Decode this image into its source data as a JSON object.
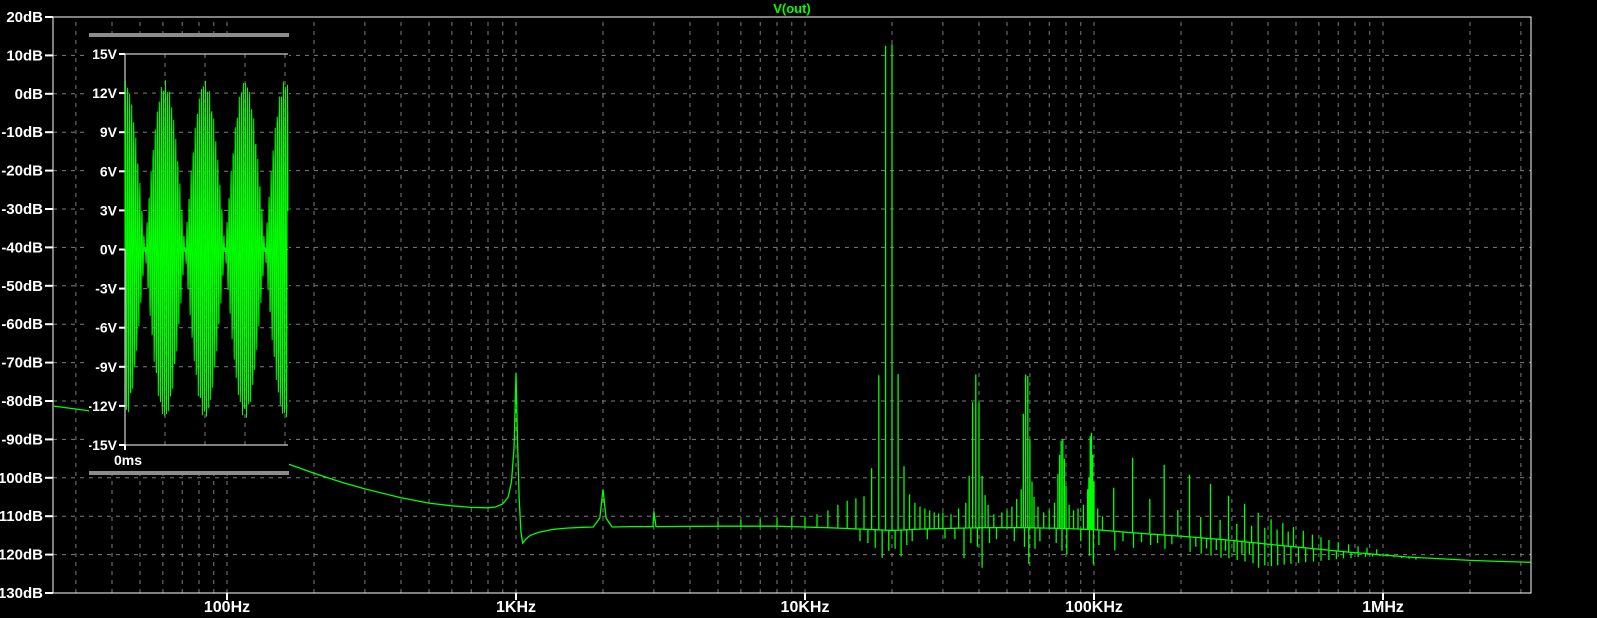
{
  "window": {
    "background": "#000000"
  },
  "colors": {
    "trace": "#00ff00",
    "grid": "#7d7d7d",
    "axis": "#ffffff",
    "text": "#ffffff",
    "title": "#00ff00",
    "pane_border": "#8c8c8c"
  },
  "chart_data": [
    {
      "type": "line",
      "title": "V(out)",
      "name": "fft-spectrum",
      "legend_position": "top-center",
      "grid": "dashed",
      "x_axis": {
        "scale": "log",
        "unit": "Hz",
        "min": 25,
        "max": 3250000,
        "tick_labels": [
          {
            "hz": 100,
            "label": "100Hz"
          },
          {
            "hz": 1000,
            "label": "1KHz"
          },
          {
            "hz": 10000,
            "label": "10KHz"
          },
          {
            "hz": 100000,
            "label": "100KHz"
          },
          {
            "hz": 1000000,
            "label": "1MHz"
          }
        ]
      },
      "y_axis": {
        "unit": "dB",
        "min": -130,
        "max": 20,
        "step": 10,
        "tick_labels": [
          {
            "db": 20,
            "label": "20dB"
          },
          {
            "db": 10,
            "label": "10dB"
          },
          {
            "db": 0,
            "label": "0dB"
          },
          {
            "db": -10,
            "label": "-10dB"
          },
          {
            "db": -20,
            "label": "-20dB"
          },
          {
            "db": -30,
            "label": "-30dB"
          },
          {
            "db": -40,
            "label": "-40dB"
          },
          {
            "db": -50,
            "label": "-50dB"
          },
          {
            "db": -60,
            "label": "-60dB"
          },
          {
            "db": -70,
            "label": "-70dB"
          },
          {
            "db": -80,
            "label": "-80dB"
          },
          {
            "db": -90,
            "label": "-90dB"
          },
          {
            "db": -100,
            "label": "-100dB"
          },
          {
            "db": -110,
            "label": "-110dB"
          },
          {
            "db": -120,
            "label": "-120dB"
          },
          {
            "db": -130,
            "label": "-130dB"
          }
        ]
      },
      "baseline_points_hz_db": [
        [
          25,
          -81.3
        ],
        [
          33,
          -82.5
        ],
        [
          60,
          -88
        ],
        [
          100,
          -92.5
        ],
        [
          163,
          -96.4
        ],
        [
          200,
          -98.8
        ],
        [
          250,
          -101.2
        ],
        [
          300,
          -102.9
        ],
        [
          400,
          -105.2
        ],
        [
          500,
          -106.6
        ],
        [
          600,
          -107.3
        ],
        [
          700,
          -107.7
        ],
        [
          800,
          -107.8
        ],
        [
          850,
          -107.6
        ],
        [
          900,
          -106.8
        ],
        [
          940,
          -105
        ],
        [
          965,
          -101
        ],
        [
          985,
          -92
        ],
        [
          1000,
          -72.6
        ],
        [
          1012,
          -90
        ],
        [
          1025,
          -105
        ],
        [
          1040,
          -114
        ],
        [
          1055,
          -117
        ],
        [
          1080,
          -116
        ],
        [
          1120,
          -115
        ],
        [
          1200,
          -114.2
        ],
        [
          1350,
          -113.4
        ],
        [
          1500,
          -113.1
        ],
        [
          1700,
          -112.9
        ],
        [
          1850,
          -112.8
        ],
        [
          1950,
          -110.5
        ],
        [
          2000,
          -103
        ],
        [
          2050,
          -110.5
        ],
        [
          2150,
          -112.8
        ],
        [
          2500,
          -112.7
        ],
        [
          2980,
          -112.7
        ],
        [
          3000,
          -108.8
        ],
        [
          3050,
          -112.7
        ],
        [
          5000,
          -112.6
        ],
        [
          8000,
          -112.6
        ],
        [
          12000,
          -113
        ],
        [
          15000,
          -113.3
        ],
        [
          20000,
          -113.7
        ],
        [
          26000,
          -113.3
        ],
        [
          40000,
          -113
        ],
        [
          60000,
          -113
        ],
        [
          80000,
          -113.2
        ],
        [
          100000,
          -113.5
        ],
        [
          130000,
          -114.2
        ],
        [
          160000,
          -114.7
        ],
        [
          200000,
          -115.2
        ],
        [
          250000,
          -115.8
        ],
        [
          300000,
          -116.3
        ],
        [
          400000,
          -117.3
        ],
        [
          500000,
          -118
        ],
        [
          600000,
          -118.6
        ],
        [
          700000,
          -119.1
        ],
        [
          800000,
          -119.5
        ],
        [
          900000,
          -119.8
        ],
        [
          1000000,
          -120.1
        ],
        [
          1200000,
          -120.6
        ],
        [
          1500000,
          -121
        ],
        [
          2000000,
          -121.5
        ],
        [
          2600000,
          -121.8
        ],
        [
          3250000,
          -122
        ]
      ],
      "spikes_hz_db": [
        [
          5000,
          -111.3
        ],
        [
          6000,
          -111
        ],
        [
          7000,
          -110.8
        ],
        [
          8000,
          -110.5
        ],
        [
          9000,
          -110.3
        ],
        [
          10000,
          -110
        ],
        [
          11000,
          -109.5
        ],
        [
          12000,
          -108.5
        ],
        [
          13000,
          -107
        ],
        [
          14000,
          -106
        ],
        [
          15000,
          -105.3
        ],
        [
          16000,
          -104.8
        ],
        [
          17000,
          -97.5
        ],
        [
          18000,
          -73.3
        ],
        [
          19000,
          12.5
        ],
        [
          20000,
          12.9
        ],
        [
          21000,
          -73
        ],
        [
          22000,
          -97
        ],
        [
          23000,
          -104.3
        ],
        [
          24000,
          -106.5
        ],
        [
          25000,
          -107.5
        ],
        [
          26000,
          -108
        ],
        [
          27000,
          -108.5
        ],
        [
          28000,
          -109
        ],
        [
          29000,
          -109.3
        ],
        [
          30000,
          -109
        ],
        [
          32000,
          -109.5
        ],
        [
          34000,
          -108
        ],
        [
          36000,
          -106.5
        ],
        [
          37000,
          -99.5
        ],
        [
          38000,
          -80.3
        ],
        [
          39000,
          -73.1
        ],
        [
          40000,
          -80.3
        ],
        [
          41000,
          -99.5
        ],
        [
          42000,
          -104.5
        ],
        [
          43000,
          -107
        ],
        [
          45000,
          -109.5
        ],
        [
          48000,
          -109
        ],
        [
          50000,
          -108.5
        ],
        [
          52000,
          -107.5
        ],
        [
          54000,
          -105.5
        ],
        [
          56000,
          -103
        ],
        [
          57000,
          -83.3
        ],
        [
          58000,
          -73.1
        ],
        [
          59000,
          -73.5
        ],
        [
          60000,
          -90
        ],
        [
          61000,
          -101
        ],
        [
          62000,
          -105
        ],
        [
          64000,
          -107.5
        ],
        [
          67000,
          -109
        ],
        [
          70000,
          -108.5
        ],
        [
          73000,
          -106.5
        ],
        [
          75000,
          -99
        ],
        [
          76000,
          -94
        ],
        [
          77000,
          -90.3
        ],
        [
          78000,
          -90
        ],
        [
          79000,
          -95
        ],
        [
          80000,
          -102
        ],
        [
          82000,
          -107
        ],
        [
          85000,
          -108.5
        ],
        [
          88000,
          -108
        ],
        [
          92000,
          -107
        ],
        [
          95000,
          -103
        ],
        [
          96000,
          -100
        ],
        [
          97000,
          -89.2
        ],
        [
          98000,
          -88.3
        ],
        [
          99000,
          -94
        ],
        [
          100000,
          -101
        ],
        [
          103000,
          -108
        ],
        [
          107000,
          -110
        ],
        [
          117000,
          -102.6
        ],
        [
          136000,
          -94.8
        ],
        [
          156000,
          -105.5
        ],
        [
          175000,
          -96.6
        ],
        [
          195000,
          -108.4
        ],
        [
          214000,
          -99.2
        ],
        [
          234000,
          -110.2
        ],
        [
          253000,
          -101.6
        ],
        [
          273000,
          -111
        ],
        [
          292000,
          -104.7
        ],
        [
          312000,
          -112
        ],
        [
          332000,
          -106.8
        ],
        [
          351000,
          -112.5
        ],
        [
          370000,
          -109.1
        ],
        [
          390000,
          -113
        ],
        [
          410000,
          -110.8
        ],
        [
          430000,
          -113.5
        ],
        [
          450000,
          -111.8
        ],
        [
          470000,
          -114
        ],
        [
          490000,
          -112.8
        ],
        [
          530000,
          -113.8
        ],
        [
          570000,
          -114.8
        ],
        [
          610000,
          -115.5
        ],
        [
          650000,
          -116.2
        ],
        [
          700000,
          -116.8
        ],
        [
          760000,
          -117.3
        ],
        [
          820000,
          -117.8
        ],
        [
          880000,
          -118.2
        ],
        [
          950000,
          -118.6
        ]
      ],
      "notches_hz_db": [
        [
          15500,
          -116.5
        ],
        [
          16500,
          -117
        ],
        [
          17500,
          -118.2
        ],
        [
          18500,
          -120.8
        ],
        [
          19500,
          -119
        ],
        [
          20500,
          -118.5
        ],
        [
          21500,
          -120.5
        ],
        [
          22500,
          -117.5
        ],
        [
          23500,
          -116.5
        ],
        [
          26500,
          -116
        ],
        [
          30500,
          -115.8
        ],
        [
          33000,
          -116
        ],
        [
          35500,
          -120.9
        ],
        [
          37500,
          -117
        ],
        [
          39500,
          -118
        ],
        [
          41000,
          -123.4
        ],
        [
          43500,
          -117
        ],
        [
          46000,
          -116
        ],
        [
          53000,
          -116.5
        ],
        [
          57500,
          -118
        ],
        [
          59500,
          -122.4
        ],
        [
          62500,
          -118.5
        ],
        [
          65000,
          -116.5
        ],
        [
          74000,
          -117
        ],
        [
          77500,
          -119
        ],
        [
          80500,
          -120
        ],
        [
          90000,
          -116.5
        ],
        [
          96500,
          -120.3
        ],
        [
          99500,
          -122.5
        ],
        [
          104000,
          -117.5
        ],
        [
          118000,
          -118.9
        ],
        [
          126000,
          -116.5
        ],
        [
          137000,
          -118.2
        ],
        [
          146000,
          -116.8
        ],
        [
          157000,
          -117.5
        ],
        [
          166000,
          -117
        ],
        [
          176000,
          -118.5
        ],
        [
          186000,
          -117.3
        ],
        [
          215000,
          -119.3
        ],
        [
          225000,
          -118
        ],
        [
          235000,
          -119.8
        ],
        [
          245000,
          -118.4
        ],
        [
          254000,
          -120.3
        ],
        [
          265000,
          -118.8
        ],
        [
          275000,
          -120.8
        ],
        [
          285000,
          -119
        ],
        [
          293000,
          -121
        ],
        [
          305000,
          -119.4
        ],
        [
          313000,
          -121.4
        ],
        [
          325000,
          -119.8
        ],
        [
          333000,
          -121.8
        ],
        [
          345000,
          -120
        ],
        [
          355000,
          -122.3
        ],
        [
          371000,
          -123.4
        ],
        [
          390000,
          -122.8
        ],
        [
          411000,
          -123
        ],
        [
          432000,
          -122.8
        ],
        [
          455000,
          -122.6
        ],
        [
          480000,
          -122.4
        ],
        [
          510000,
          -122.2
        ],
        [
          540000,
          -122
        ],
        [
          575000,
          -121.8
        ],
        [
          610000,
          -121.6
        ],
        [
          650000,
          -121.4
        ],
        [
          690000,
          -121.2
        ],
        [
          730000,
          -121
        ],
        [
          775000,
          -120.9
        ],
        [
          820000,
          -120.7
        ],
        [
          870000,
          -120.6
        ],
        [
          920000,
          -120.5
        ],
        [
          975000,
          -120.4
        ],
        [
          1030000,
          -120.5
        ],
        [
          1090000,
          -120.7
        ],
        [
          1160000,
          -120.9
        ],
        [
          1230000,
          -121.1
        ],
        [
          1300000,
          -121.3
        ]
      ]
    },
    {
      "type": "line",
      "title": "",
      "name": "time-domain-inset",
      "grid": "dashed",
      "x_axis": {
        "unit": "ms",
        "min": 0,
        "max": 4.075,
        "tick_labels": [
          {
            "ms": 0,
            "label": "0ms"
          }
        ]
      },
      "y_axis": {
        "unit": "V",
        "min": -15,
        "max": 15,
        "step": 3,
        "tick_labels": [
          {
            "v": 15,
            "label": "15V"
          },
          {
            "v": 12,
            "label": "12V"
          },
          {
            "v": 9,
            "label": "9V"
          },
          {
            "v": 6,
            "label": "6V"
          },
          {
            "v": 3,
            "label": "3V"
          },
          {
            "v": 0,
            "label": "0V"
          },
          {
            "v": -3,
            "label": "-3V"
          },
          {
            "v": -6,
            "label": "-6V"
          },
          {
            "v": -9,
            "label": "-9V"
          },
          {
            "v": -12,
            "label": "-12V"
          },
          {
            "v": -15,
            "label": "-15V"
          }
        ]
      },
      "signal": {
        "description": "two-tone beat waveform, 1 kHz envelope, ~13 V peak",
        "tone1_hz": 19000,
        "tone2_hz": 20000,
        "amplitude_per_tone_v": 6.5,
        "duration_ms": 4.075
      }
    }
  ]
}
